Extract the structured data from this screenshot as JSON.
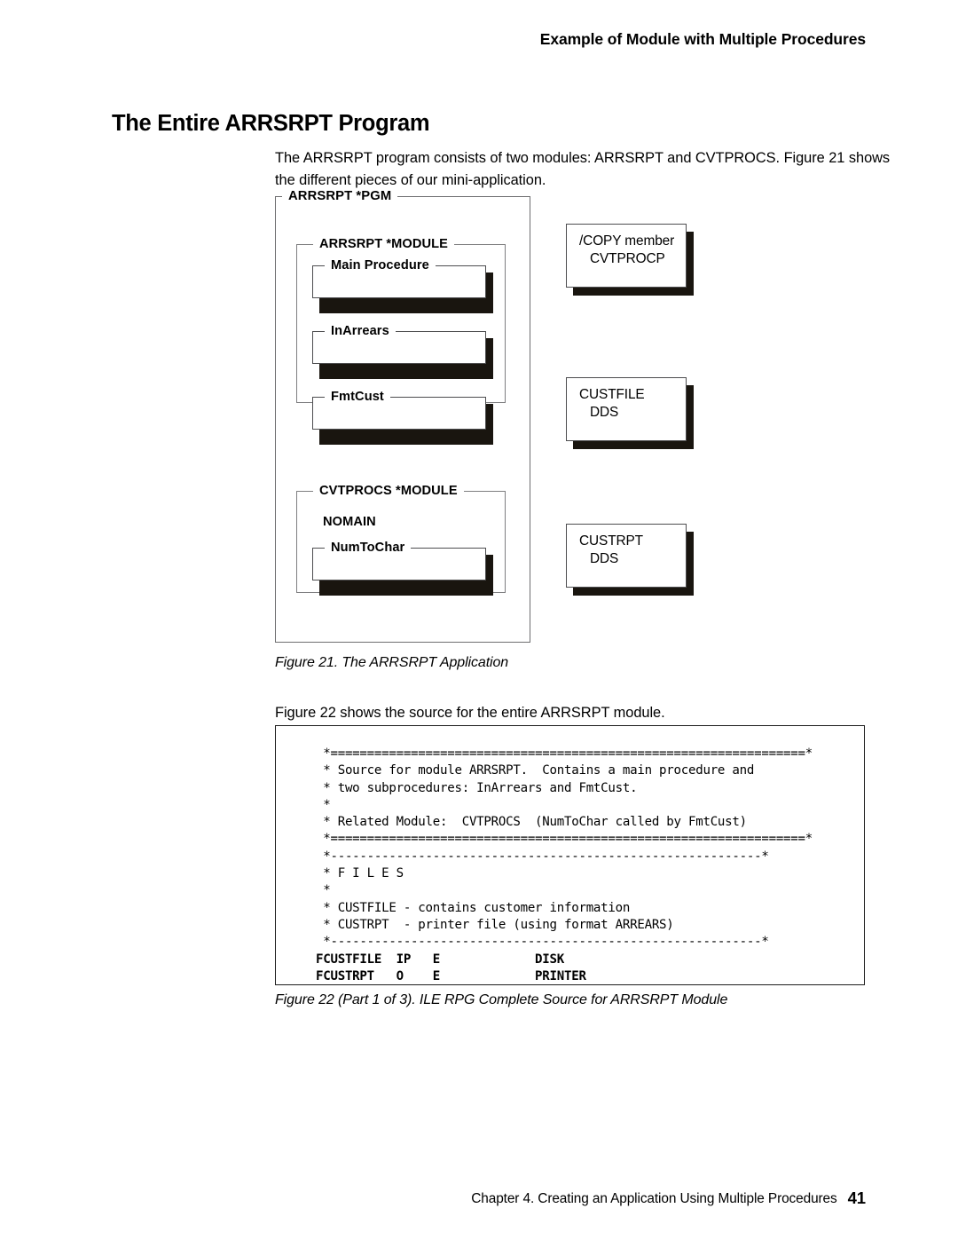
{
  "header": {
    "running_title": "Example of Module with Multiple Procedures"
  },
  "headline": "The Entire ARRSRPT Program",
  "paragraphs": {
    "intro": "The ARRSRPT program consists of two modules: ARRSRPT and CVTPROCS. Figure 21 shows the different pieces of our mini-application.",
    "source": "Figure 22 shows the source for the entire ARRSRPT module."
  },
  "figure_21": {
    "caption": "Figure 21. The ARRSRPT Application",
    "pgm_frame_label": "ARRSRPT *PGM",
    "modules": [
      {
        "label": "ARRSRPT *MODULE",
        "procedures": [
          "Main Procedure",
          "InArrears",
          "FmtCust"
        ]
      },
      {
        "label": "CVTPROCS *MODULE",
        "keyword": "NOMAIN",
        "procedures": [
          "NumToChar"
        ]
      }
    ],
    "cards": [
      {
        "line1": "/COPY member",
        "line2": "CVTPROCP"
      },
      {
        "line1": "CUSTFILE",
        "line2": "DDS"
      },
      {
        "line1": "CUSTRPT",
        "line2": "DDS"
      }
    ]
  },
  "figure_22": {
    "caption": "Figure 22 (Part 1 of 3). ILE RPG Complete Source for ARRSRPT Module",
    "code_plain": " *=================================================================*\n * Source for module ARRSRPT.  Contains a main procedure and\n * two subprocedures: InArrears and FmtCust.\n *\n * Related Module:  CVTPROCS  (NumToChar called by FmtCust)\n *=================================================================*\n *-----------------------------------------------------------*\n * F I L E S\n *\n * CUSTFILE - contains customer information\n * CUSTRPT  - printer file (using format ARREARS)\n *-----------------------------------------------------------*\n",
    "code_bold": "FCUSTFILE  IP   E             DISK\nFCUSTRPT   O    E             PRINTER"
  },
  "footer": {
    "chapter_line": "Chapter 4.  Creating an Application Using Multiple Procedures",
    "page_number": "41"
  },
  "colors": {
    "text": "#000000",
    "shadow": "#19150f",
    "frame_line": "#7e7e80",
    "box_line": "#4d4d4f"
  }
}
